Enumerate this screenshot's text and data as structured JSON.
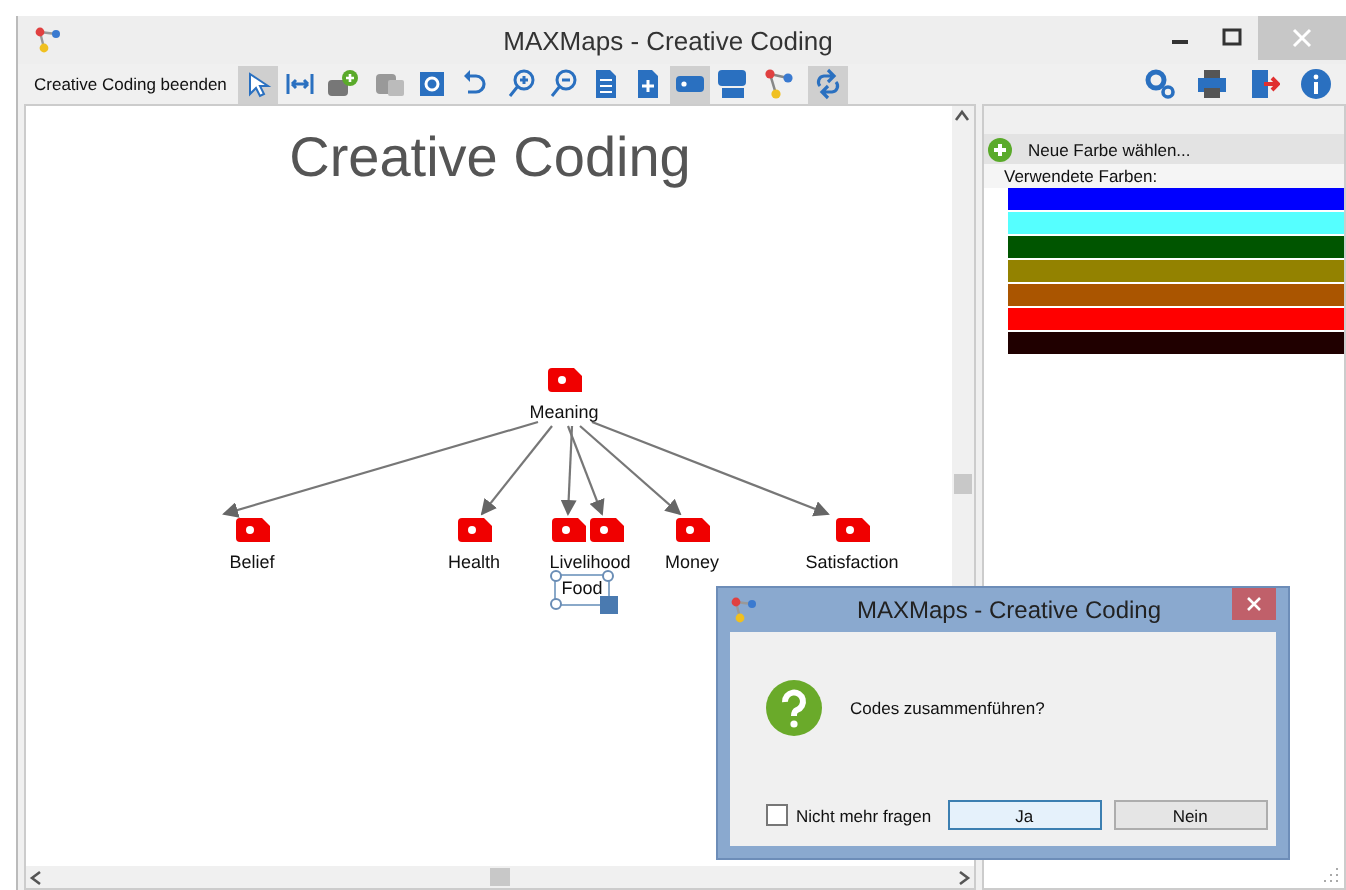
{
  "window": {
    "title": "MAXMaps - Creative Coding"
  },
  "toolbar": {
    "exit_button": "Creative Coding beenden",
    "buttons": [
      {
        "selected": true
      },
      {
        "selected": false
      },
      {
        "selected": false
      },
      {
        "selected": false
      },
      {
        "selected": false
      },
      {
        "selected": false
      },
      {
        "selected": false
      },
      {
        "selected": false
      },
      {
        "selected": false
      },
      {
        "selected": false
      },
      {
        "selected": true
      },
      {
        "selected": false
      },
      {
        "selected": false
      },
      {
        "selected": true
      }
    ]
  },
  "canvas": {
    "title": "Creative Coding",
    "nodes": [
      {
        "label": "Meaning",
        "selected": false
      },
      {
        "label": "Belief",
        "selected": false
      },
      {
        "label": "Health",
        "selected": false
      },
      {
        "label": "Livelihood",
        "selected": false
      },
      {
        "label": "Food",
        "selected": true
      },
      {
        "label": "Money",
        "selected": false
      },
      {
        "label": "Satisfaction",
        "selected": false
      }
    ]
  },
  "color_panel": {
    "new_color": "Neue Farbe wählen...",
    "used_label": "Verwendete Farben:",
    "colors": [
      {
        "color": "#0000ff"
      },
      {
        "color": "#55ffff"
      },
      {
        "color": "#005500"
      },
      {
        "color": "#938200"
      },
      {
        "color": "#aa5500"
      },
      {
        "color": "#ff0000"
      },
      {
        "color": "#200000"
      }
    ]
  },
  "dialog": {
    "title": "MAXMaps - Creative Coding",
    "message": "Codes zusammenführen?",
    "checkbox": {
      "label": "Nicht mehr fragen",
      "checked": false
    },
    "buttons": [
      {
        "label": "Ja",
        "selected": true
      },
      {
        "label": "Nein",
        "selected": false
      }
    ]
  }
}
